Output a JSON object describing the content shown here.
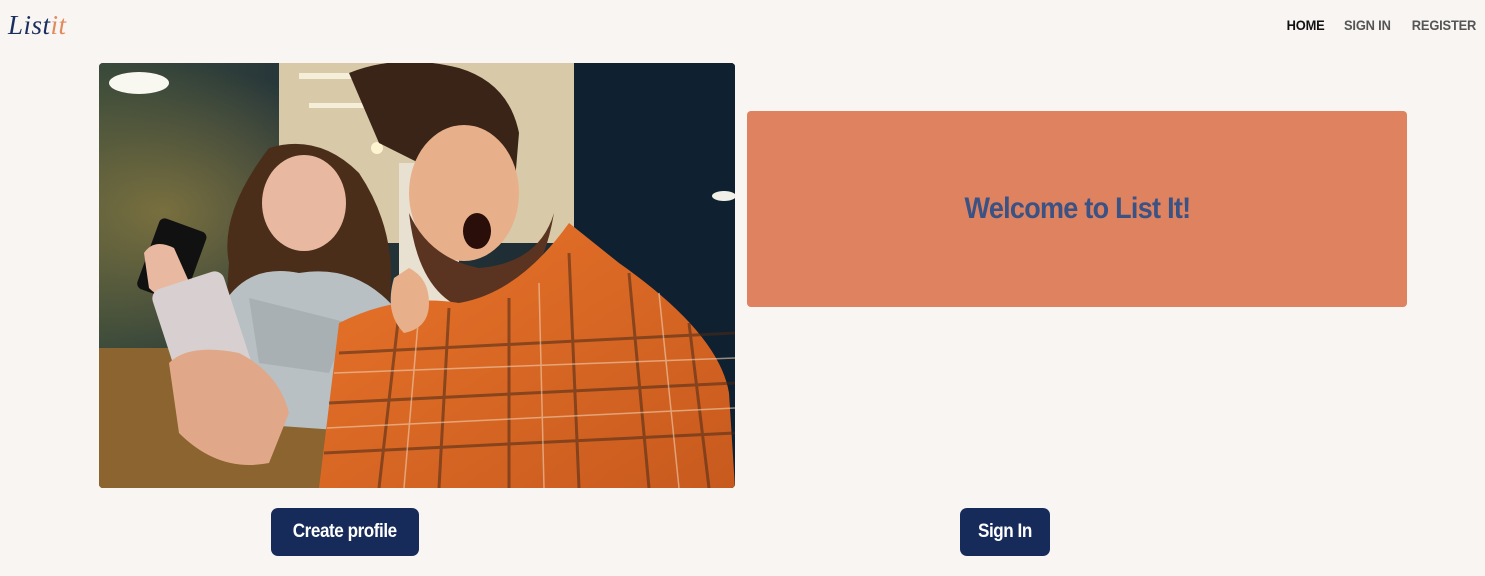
{
  "brand": {
    "part1": "List",
    "part2": "it",
    "color1": "#1b2f5e",
    "color2": "#e08a5e"
  },
  "nav": {
    "home": "HOME",
    "signin": "SIGN IN",
    "register": "REGISTER"
  },
  "hero": {
    "image_icon": "photo-of-two-excited-people-looking-at-phone"
  },
  "welcome": {
    "heading": "Welcome to List It!",
    "bg_color": "#df825f",
    "text_color": "#3b5284"
  },
  "actions": {
    "create_profile": "Create profile",
    "sign_in": "Sign In",
    "button_color": "#172b5a"
  }
}
